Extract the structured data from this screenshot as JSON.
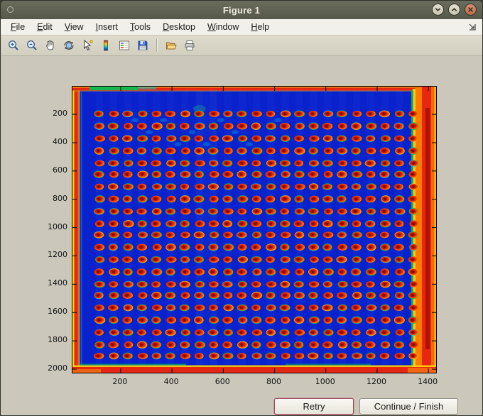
{
  "window": {
    "title": "Figure 1",
    "controls": [
      {
        "name": "shade-button",
        "icon": "chevron-down-icon"
      },
      {
        "name": "maximize-button",
        "icon": "chevron-up-icon"
      },
      {
        "name": "close-button",
        "icon": "close-icon"
      }
    ]
  },
  "menu": {
    "items": [
      {
        "label": "File"
      },
      {
        "label": "Edit"
      },
      {
        "label": "View"
      },
      {
        "label": "Insert"
      },
      {
        "label": "Tools"
      },
      {
        "label": "Desktop"
      },
      {
        "label": "Window"
      },
      {
        "label": "Help"
      }
    ]
  },
  "toolbar": {
    "buttons": [
      {
        "icon": "zoom-in-icon"
      },
      {
        "icon": "zoom-out-icon"
      },
      {
        "icon": "pan-hand-icon"
      },
      {
        "icon": "rotate-3d-icon"
      },
      {
        "icon": "data-cursor-icon"
      },
      {
        "icon": "colorbar-icon"
      },
      {
        "icon": "legend-icon"
      },
      {
        "icon": "save-icon"
      },
      {
        "icon": "separator"
      },
      {
        "icon": "open-folder-icon"
      },
      {
        "icon": "print-icon"
      }
    ]
  },
  "figure": {
    "buttons": [
      {
        "name": "retry-button",
        "label": "Retry"
      },
      {
        "name": "continue-finish-button",
        "label": "Continue / Finish"
      }
    ]
  },
  "chart_data": {
    "type": "heatmap",
    "title": "",
    "xlabel": "",
    "ylabel": "",
    "colormap": "jet",
    "description": "Microplate / array image rendered with jet colormap: dark blue field, grid of red-orange wells with yellow-green rims, saturated red/orange borders along all image edges, wide red-orange band on the right edge.",
    "xticks": [
      200,
      400,
      600,
      800,
      1000,
      1200,
      1400
    ],
    "yticks": [
      200,
      400,
      600,
      800,
      1000,
      1200,
      1400,
      1600,
      1800,
      2000
    ],
    "x_domain": [
      12,
      1430
    ],
    "y_domain": [
      4,
      2025
    ],
    "grid_on": false,
    "legend": "none",
    "wells": {
      "rows": 21,
      "cols": 23,
      "x_start": 117,
      "x_step": 55.7,
      "y_start": 200,
      "y_step": 85.5
    },
    "colors": {
      "field": "#0a22cc",
      "field_light": "#2e5df0",
      "red": "#e62812",
      "dark_red": "#b01205",
      "orange": "#ff7a00",
      "yellow": "#ffd400",
      "green": "#00c455",
      "cyan": "#00dcd8"
    }
  }
}
